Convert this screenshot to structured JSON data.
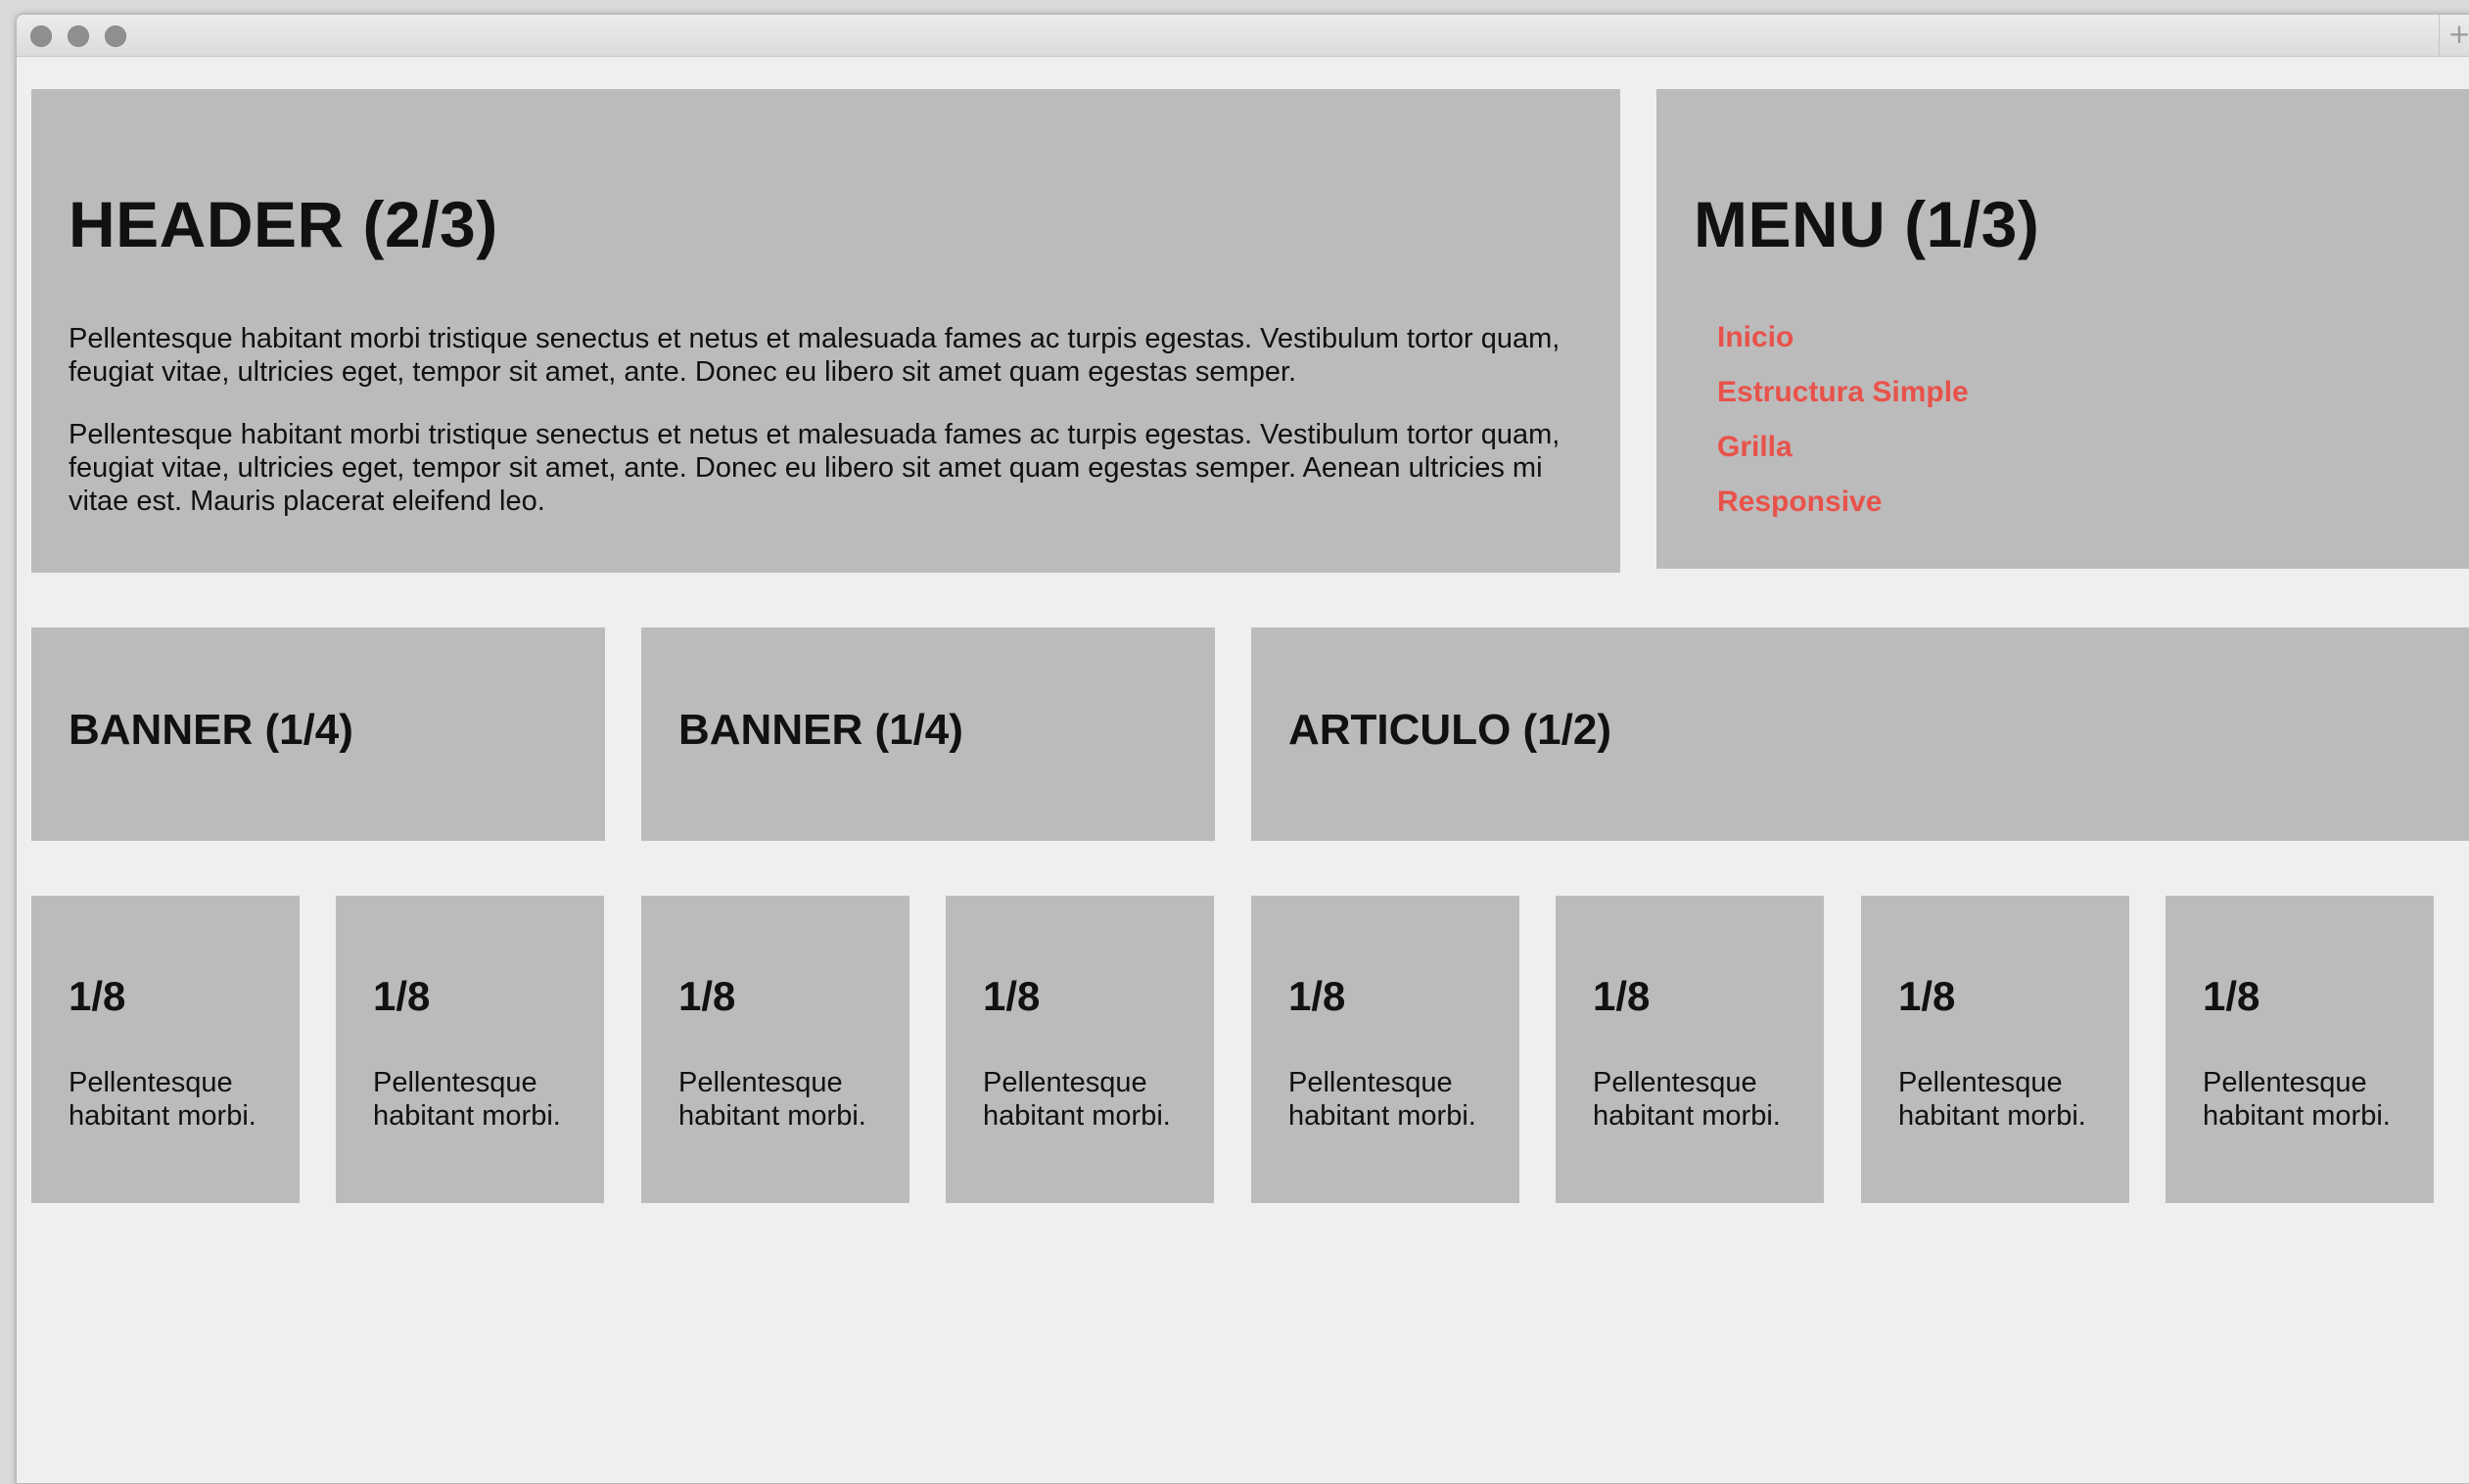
{
  "browser": {
    "new_tab_icon": "plus-icon",
    "new_tab_glyph": "+"
  },
  "header": {
    "title": "HEADER (2/3)",
    "paragraphs": [
      "Pellentesque habitant morbi tristique senectus et netus et malesuada fames ac turpis egestas. Vestibulum tortor quam, feugiat vitae, ultricies eget, tempor sit amet, ante. Donec eu libero sit amet quam egestas semper.",
      "Pellentesque habitant morbi tristique senectus et netus et malesuada fames ac turpis egestas. Vestibulum tortor quam, feugiat vitae, ultricies eget, tempor sit amet, ante. Donec eu libero sit amet quam egestas semper. Aenean ultricies mi vitae est. Mauris placerat eleifend leo."
    ]
  },
  "menu": {
    "title": "MENU (1/3)",
    "items": [
      {
        "label": "Inicio"
      },
      {
        "label": "Estructura Simple"
      },
      {
        "label": "Grilla"
      },
      {
        "label": "Responsive"
      }
    ],
    "link_color": "#e8524a"
  },
  "row2": {
    "banner1": "BANNER (1/4)",
    "banner2": "BANNER (1/4)",
    "article": "ARTICULO (1/2)"
  },
  "eighths": [
    {
      "title": "1/8",
      "text": "Pellentesque habitant morbi."
    },
    {
      "title": "1/8",
      "text": "Pellentesque habitant morbi."
    },
    {
      "title": "1/8",
      "text": "Pellentesque habitant morbi."
    },
    {
      "title": "1/8",
      "text": "Pellentesque habitant morbi."
    },
    {
      "title": "1/8",
      "text": "Pellentesque habitant morbi."
    },
    {
      "title": "1/8",
      "text": "Pellentesque habitant morbi."
    },
    {
      "title": "1/8",
      "text": "Pellentesque habitant morbi."
    },
    {
      "title": "1/8",
      "text": "Pellentesque habitant morbi."
    }
  ],
  "colors": {
    "page_background": "#efefef",
    "box_background": "#bbbbbb",
    "text": "#111111"
  }
}
